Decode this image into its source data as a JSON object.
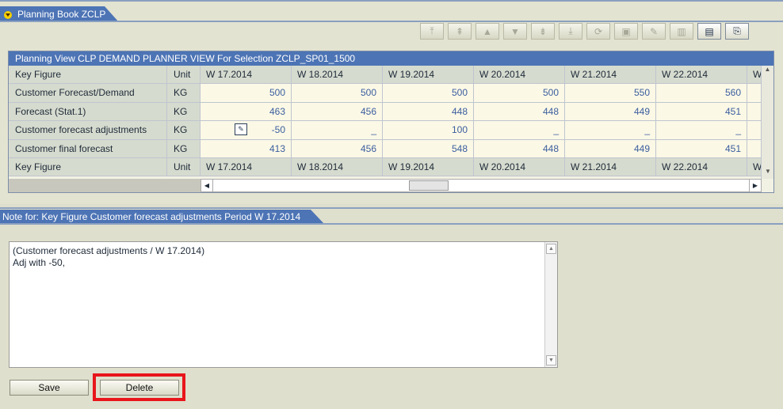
{
  "planning_book": {
    "tab_title": "Planning Book ZCLP"
  },
  "toolbar": {
    "buttons": [
      {
        "icon": "first-row-icon",
        "glyph": "⤒",
        "enabled": false
      },
      {
        "icon": "page-up-icon",
        "glyph": "⇞",
        "enabled": false
      },
      {
        "icon": "row-up-icon",
        "glyph": "▲",
        "enabled": false
      },
      {
        "icon": "row-down-icon",
        "glyph": "▼",
        "enabled": false
      },
      {
        "icon": "page-down-icon",
        "glyph": "⇟",
        "enabled": false
      },
      {
        "icon": "last-row-icon",
        "glyph": "⤓",
        "enabled": false
      },
      {
        "icon": "refresh-icon",
        "glyph": "⟳",
        "enabled": false
      },
      {
        "icon": "save-layout-icon",
        "glyph": "▣",
        "enabled": false
      },
      {
        "icon": "edit-icon",
        "glyph": "✎",
        "enabled": false
      },
      {
        "icon": "chart-icon",
        "glyph": "▥",
        "enabled": false
      },
      {
        "icon": "notes-overview-icon",
        "glyph": "▤",
        "enabled": true
      },
      {
        "icon": "export-icon",
        "glyph": "⎘",
        "enabled": true
      }
    ]
  },
  "grid": {
    "title": "Planning View CLP DEMAND PLANNER VIEW For Selection ZCLP_SP01_1500",
    "headers": [
      "Key Figure",
      "Unit",
      "W 17.2014",
      "W 18.2014",
      "W 19.2014",
      "W 20.2014",
      "W 21.2014",
      "W 22.2014",
      "W..."
    ],
    "rows": [
      {
        "key_figure": "Customer Forecast/Demand",
        "unit": "KG",
        "values": [
          "500",
          "500",
          "500",
          "500",
          "550",
          "560",
          ""
        ]
      },
      {
        "key_figure": "Forecast (Stat.1)",
        "unit": "KG",
        "values": [
          "463",
          "456",
          "448",
          "448",
          "449",
          "451",
          ""
        ]
      },
      {
        "key_figure": "Customer forecast adjustments",
        "unit": "KG",
        "values": [
          "-50",
          "_",
          "100",
          "_",
          "_",
          "_",
          ""
        ]
      },
      {
        "key_figure": "Customer final forecast",
        "unit": "KG",
        "values": [
          "413",
          "456",
          "548",
          "448",
          "449",
          "451",
          ""
        ]
      }
    ],
    "footer": [
      "Key Figure",
      "Unit",
      "W 17.2014",
      "W 18.2014",
      "W 19.2014",
      "W 20.2014",
      "W 21.2014",
      "W 22.2014",
      "W..."
    ]
  },
  "note": {
    "tab_title": "Note for: Key Figure Customer forecast adjustments Period W 17.2014",
    "text": "(Customer forecast adjustments / W 17.2014)\nAdj with -50,",
    "save_label": "Save",
    "delete_label": "Delete"
  },
  "colors": {
    "accent": "#4d74b5",
    "highlight": "#e8161b"
  }
}
